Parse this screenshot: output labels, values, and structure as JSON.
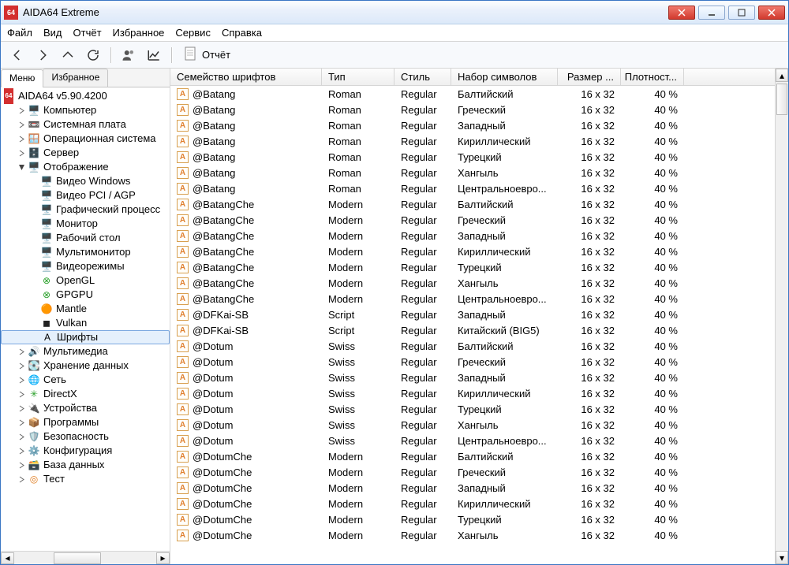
{
  "title": "AIDA64 Extreme",
  "menu": {
    "items": [
      "Файл",
      "Вид",
      "Отчёт",
      "Избранное",
      "Сервис",
      "Справка"
    ]
  },
  "toolbar": {
    "report": "Отчёт"
  },
  "tabs": {
    "menu": "Меню",
    "fav": "Избранное"
  },
  "root_label": "AIDA64 v5.90.4200",
  "tree": [
    {
      "l": "Компьютер",
      "d": 1,
      "ic": "pc",
      "tw": ">"
    },
    {
      "l": "Системная плата",
      "d": 1,
      "ic": "mb",
      "tw": ">"
    },
    {
      "l": "Операционная система",
      "d": 1,
      "ic": "os",
      "tw": ">"
    },
    {
      "l": "Сервер",
      "d": 1,
      "ic": "srv",
      "tw": ">"
    },
    {
      "l": "Отображение",
      "d": 1,
      "ic": "disp",
      "tw": "v"
    },
    {
      "l": "Видео Windows",
      "d": 2,
      "ic": "mon"
    },
    {
      "l": "Видео PCI / AGP",
      "d": 2,
      "ic": "mon"
    },
    {
      "l": "Графический процесс",
      "d": 2,
      "ic": "gpu"
    },
    {
      "l": "Монитор",
      "d": 2,
      "ic": "mon"
    },
    {
      "l": "Рабочий стол",
      "d": 2,
      "ic": "mon"
    },
    {
      "l": "Мультимонитор",
      "d": 2,
      "ic": "mmon"
    },
    {
      "l": "Видеорежимы",
      "d": 2,
      "ic": "mon"
    },
    {
      "l": "OpenGL",
      "d": 2,
      "ic": "ogl"
    },
    {
      "l": "GPGPU",
      "d": 2,
      "ic": "ogl"
    },
    {
      "l": "Mantle",
      "d": 2,
      "ic": "mantle"
    },
    {
      "l": "Vulkan",
      "d": 2,
      "ic": "vulkan"
    },
    {
      "l": "Шрифты",
      "d": 2,
      "ic": "font",
      "sel": true
    },
    {
      "l": "Мультимедиа",
      "d": 1,
      "ic": "mm",
      "tw": ">"
    },
    {
      "l": "Хранение данных",
      "d": 1,
      "ic": "hdd",
      "tw": ">"
    },
    {
      "l": "Сеть",
      "d": 1,
      "ic": "net",
      "tw": ">"
    },
    {
      "l": "DirectX",
      "d": 1,
      "ic": "dx",
      "tw": ">"
    },
    {
      "l": "Устройства",
      "d": 1,
      "ic": "dev",
      "tw": ">"
    },
    {
      "l": "Программы",
      "d": 1,
      "ic": "soft",
      "tw": ">"
    },
    {
      "l": "Безопасность",
      "d": 1,
      "ic": "sec",
      "tw": ">"
    },
    {
      "l": "Конфигурация",
      "d": 1,
      "ic": "cfg",
      "tw": ">"
    },
    {
      "l": "База данных",
      "d": 1,
      "ic": "db",
      "tw": ">"
    },
    {
      "l": "Тест",
      "d": 1,
      "ic": "test",
      "tw": ">"
    }
  ],
  "columns": [
    "Семейство шрифтов",
    "Тип",
    "Стиль",
    "Набор символов",
    "Размер ...",
    "Плотност..."
  ],
  "rows": [
    {
      "n": "@Batang",
      "t": "Roman",
      "s": "Regular",
      "c": "Балтийский",
      "sz": "16 x 32",
      "d": "40 %"
    },
    {
      "n": "@Batang",
      "t": "Roman",
      "s": "Regular",
      "c": "Греческий",
      "sz": "16 x 32",
      "d": "40 %"
    },
    {
      "n": "@Batang",
      "t": "Roman",
      "s": "Regular",
      "c": "Западный",
      "sz": "16 x 32",
      "d": "40 %"
    },
    {
      "n": "@Batang",
      "t": "Roman",
      "s": "Regular",
      "c": "Кириллический",
      "sz": "16 x 32",
      "d": "40 %"
    },
    {
      "n": "@Batang",
      "t": "Roman",
      "s": "Regular",
      "c": "Турецкий",
      "sz": "16 x 32",
      "d": "40 %"
    },
    {
      "n": "@Batang",
      "t": "Roman",
      "s": "Regular",
      "c": "Хангыль",
      "sz": "16 x 32",
      "d": "40 %"
    },
    {
      "n": "@Batang",
      "t": "Roman",
      "s": "Regular",
      "c": "Центральноевро...",
      "sz": "16 x 32",
      "d": "40 %"
    },
    {
      "n": "@BatangChe",
      "t": "Modern",
      "s": "Regular",
      "c": "Балтийский",
      "sz": "16 x 32",
      "d": "40 %"
    },
    {
      "n": "@BatangChe",
      "t": "Modern",
      "s": "Regular",
      "c": "Греческий",
      "sz": "16 x 32",
      "d": "40 %"
    },
    {
      "n": "@BatangChe",
      "t": "Modern",
      "s": "Regular",
      "c": "Западный",
      "sz": "16 x 32",
      "d": "40 %"
    },
    {
      "n": "@BatangChe",
      "t": "Modern",
      "s": "Regular",
      "c": "Кириллический",
      "sz": "16 x 32",
      "d": "40 %"
    },
    {
      "n": "@BatangChe",
      "t": "Modern",
      "s": "Regular",
      "c": "Турецкий",
      "sz": "16 x 32",
      "d": "40 %"
    },
    {
      "n": "@BatangChe",
      "t": "Modern",
      "s": "Regular",
      "c": "Хангыль",
      "sz": "16 x 32",
      "d": "40 %"
    },
    {
      "n": "@BatangChe",
      "t": "Modern",
      "s": "Regular",
      "c": "Центральноевро...",
      "sz": "16 x 32",
      "d": "40 %"
    },
    {
      "n": "@DFKai-SB",
      "t": "Script",
      "s": "Regular",
      "c": "Западный",
      "sz": "16 x 32",
      "d": "40 %"
    },
    {
      "n": "@DFKai-SB",
      "t": "Script",
      "s": "Regular",
      "c": "Китайский (BIG5)",
      "sz": "16 x 32",
      "d": "40 %"
    },
    {
      "n": "@Dotum",
      "t": "Swiss",
      "s": "Regular",
      "c": "Балтийский",
      "sz": "16 x 32",
      "d": "40 %"
    },
    {
      "n": "@Dotum",
      "t": "Swiss",
      "s": "Regular",
      "c": "Греческий",
      "sz": "16 x 32",
      "d": "40 %"
    },
    {
      "n": "@Dotum",
      "t": "Swiss",
      "s": "Regular",
      "c": "Западный",
      "sz": "16 x 32",
      "d": "40 %"
    },
    {
      "n": "@Dotum",
      "t": "Swiss",
      "s": "Regular",
      "c": "Кириллический",
      "sz": "16 x 32",
      "d": "40 %"
    },
    {
      "n": "@Dotum",
      "t": "Swiss",
      "s": "Regular",
      "c": "Турецкий",
      "sz": "16 x 32",
      "d": "40 %"
    },
    {
      "n": "@Dotum",
      "t": "Swiss",
      "s": "Regular",
      "c": "Хангыль",
      "sz": "16 x 32",
      "d": "40 %"
    },
    {
      "n": "@Dotum",
      "t": "Swiss",
      "s": "Regular",
      "c": "Центральноевро...",
      "sz": "16 x 32",
      "d": "40 %"
    },
    {
      "n": "@DotumChe",
      "t": "Modern",
      "s": "Regular",
      "c": "Балтийский",
      "sz": "16 x 32",
      "d": "40 %"
    },
    {
      "n": "@DotumChe",
      "t": "Modern",
      "s": "Regular",
      "c": "Греческий",
      "sz": "16 x 32",
      "d": "40 %"
    },
    {
      "n": "@DotumChe",
      "t": "Modern",
      "s": "Regular",
      "c": "Западный",
      "sz": "16 x 32",
      "d": "40 %"
    },
    {
      "n": "@DotumChe",
      "t": "Modern",
      "s": "Regular",
      "c": "Кириллический",
      "sz": "16 x 32",
      "d": "40 %"
    },
    {
      "n": "@DotumChe",
      "t": "Modern",
      "s": "Regular",
      "c": "Турецкий",
      "sz": "16 x 32",
      "d": "40 %"
    },
    {
      "n": "@DotumChe",
      "t": "Modern",
      "s": "Regular",
      "c": "Хангыль",
      "sz": "16 x 32",
      "d": "40 %"
    }
  ]
}
